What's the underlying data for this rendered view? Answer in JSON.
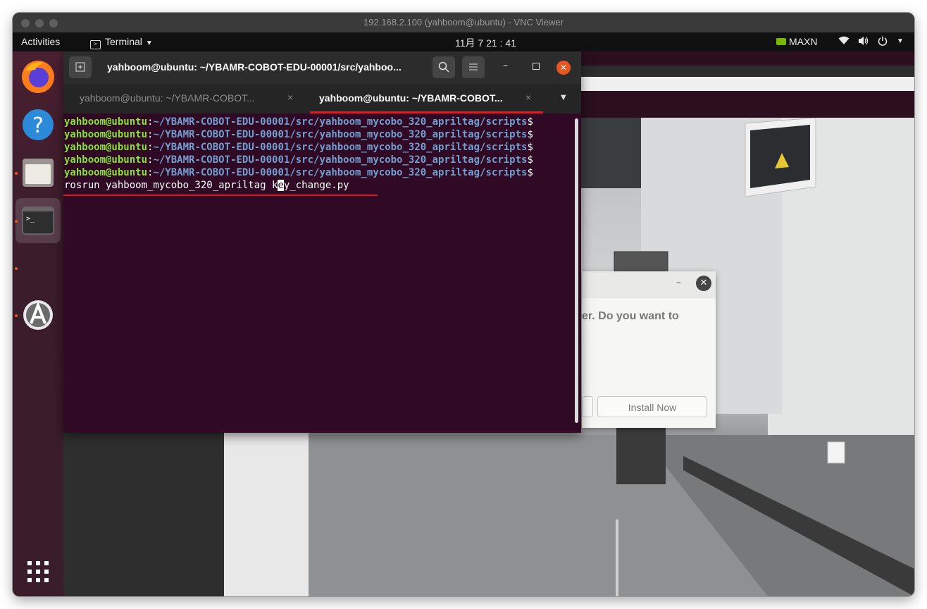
{
  "vnc": {
    "title": "192.168.2.100 (yahboom@ubuntu) - VNC Viewer"
  },
  "topbar": {
    "activities": "Activities",
    "app_menu": "Terminal",
    "clock": "11月 7  21 : 41",
    "gpu_mode": "MAXN"
  },
  "dock": {
    "items": [
      "firefox-icon",
      "help-icon",
      "files-icon",
      "terminal-icon",
      "software-icon",
      "app-grid-icon"
    ]
  },
  "terminal": {
    "header_title": "yahboom@ubuntu: ~/YBAMR-COBOT-EDU-00001/src/yahboo...",
    "tabs": [
      {
        "label": "yahboom@ubuntu: ~/YBAMR-COBOT...",
        "close": "×"
      },
      {
        "label": "yahboom@ubuntu: ~/YBAMR-COBOT...",
        "close": "×"
      }
    ],
    "prompt_user": "yahboom@ubuntu",
    "prompt_sep": ":",
    "prompt_path": "~/YBAMR-COBOT-EDU-00001/src/yahboom_mycobo_320_apriltag/scripts",
    "prompt_end": "$",
    "command_before_cursor": "rosrun yahboom_mycobo_320_apriltag k",
    "command_cursor_char": "e",
    "command_after_cursor": "y_change.py"
  },
  "dialog": {
    "text": "er. Do you want to",
    "install_button": "Install Now"
  },
  "colors": {
    "accent": "#e95420",
    "underline": "#e01b24",
    "terminal_bg": "#300a24"
  }
}
